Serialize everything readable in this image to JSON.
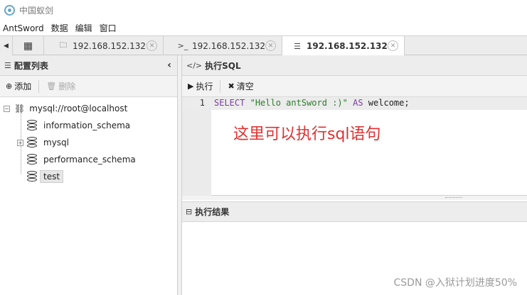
{
  "window": {
    "title": "中国蚁剑"
  },
  "menubar": {
    "items": [
      "AntSword",
      "数据",
      "编辑",
      "窗口"
    ]
  },
  "tabs": [
    {
      "label": "192.168.152.132",
      "icon": "folder-icon"
    },
    {
      "label": "192.168.152.132",
      "icon": "terminal-icon"
    },
    {
      "label": "192.168.152.132",
      "icon": "database-icon"
    }
  ],
  "left_panel": {
    "title": "配置列表",
    "toolbar": {
      "add_label": "添加",
      "delete_label": "删除"
    },
    "tree": {
      "root": "mysql://root@localhost",
      "children": [
        "information_schema",
        "mysql",
        "performance_schema",
        "test"
      ],
      "selected": "test"
    }
  },
  "right_panel": {
    "title": "执行SQL",
    "toolbar": {
      "execute_label": "执行",
      "clear_label": "清空"
    },
    "editor": {
      "line_number": "1",
      "tokens": {
        "select": "SELECT",
        "string": "\"Hello antSword :)\"",
        "as": "AS",
        "alias": "welcome;"
      },
      "annotation": "这里可以执行sql语句"
    },
    "result_title": "执行结果"
  },
  "watermark": "CSDN @入狱计划进度50%"
}
